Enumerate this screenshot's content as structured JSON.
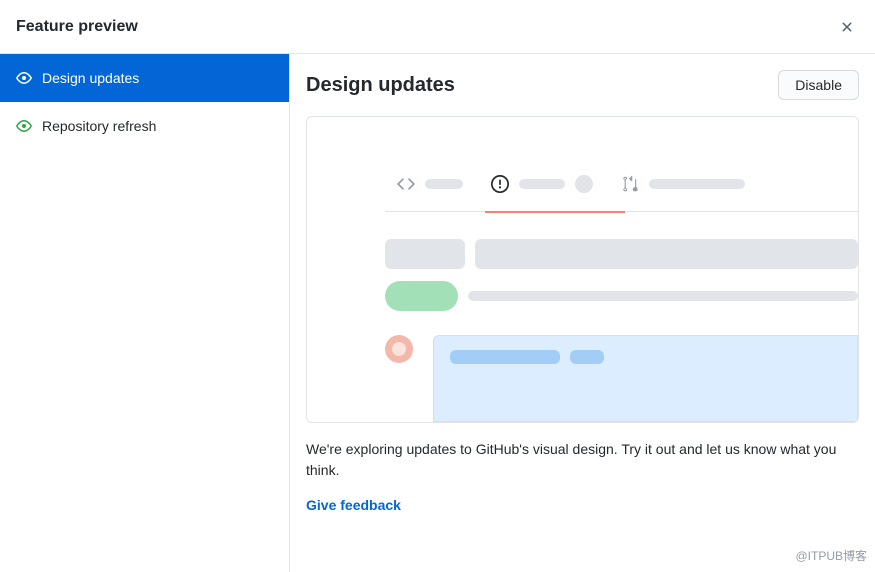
{
  "header": {
    "title": "Feature preview"
  },
  "sidebar": {
    "items": [
      {
        "label": "Design updates",
        "active": true
      },
      {
        "label": "Repository refresh",
        "active": false
      }
    ]
  },
  "content": {
    "title": "Design updates",
    "disable_label": "Disable",
    "description": "We're exploring updates to GitHub's visual design. Try it out and let us know what you think.",
    "feedback_label": "Give feedback"
  },
  "watermark": "@ITPUB博客"
}
